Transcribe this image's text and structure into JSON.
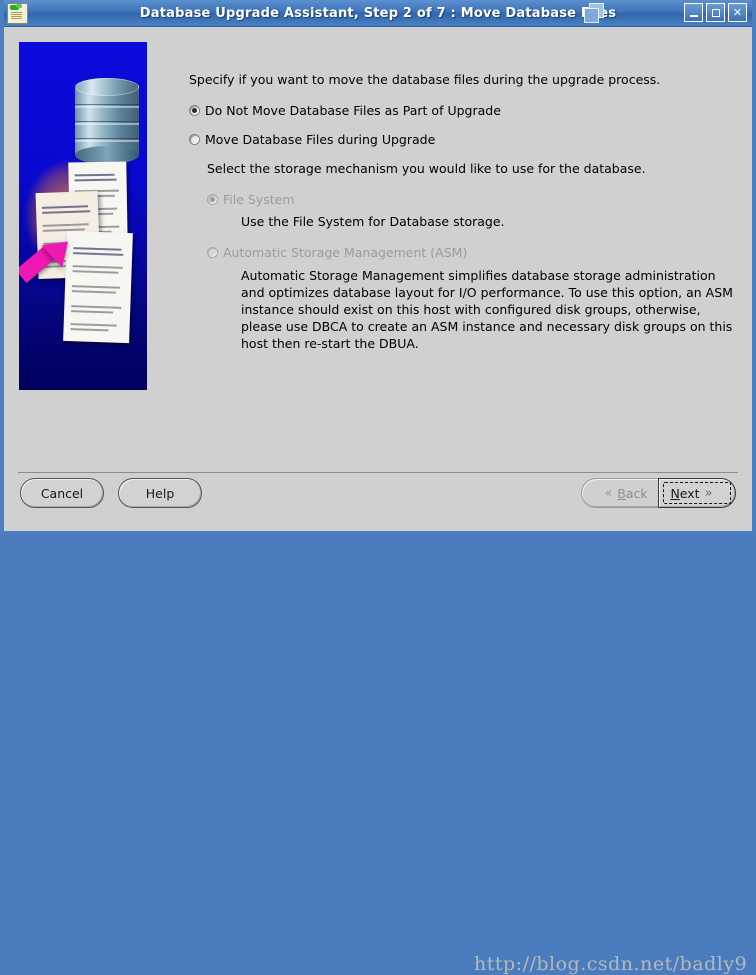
{
  "window": {
    "title": "Database Upgrade Assistant, Step 2 of 7 : Move Database Files",
    "app_icon": "database-upgrade-assistant-icon",
    "title_glyph": "stacked-windows-icon",
    "controls": {
      "minimize": "_",
      "maximize": "□",
      "close": "✕"
    }
  },
  "sidebar_graphic": {
    "name": "database-files-illustration",
    "background_top_color": "#0b0bdc",
    "background_bottom_color": "#00005c",
    "arrow_color": "#ef18b4",
    "glow_color": "#ff7a28"
  },
  "main": {
    "intro": "Specify if you want to move the database files during the upgrade process.",
    "options": [
      {
        "label": "Do Not Move Database Files as Part of Upgrade",
        "selected": true,
        "disabled": false
      },
      {
        "label": "Move Database Files during Upgrade",
        "selected": false,
        "disabled": false
      }
    ],
    "storage_prompt": "Select the storage mechanism you would like to use for the database.",
    "storage_options": [
      {
        "label": "File System",
        "selected": true,
        "disabled": true,
        "description": "Use the File System for Database storage."
      },
      {
        "label": "Automatic Storage Management (ASM)",
        "selected": false,
        "disabled": true,
        "description": "Automatic Storage Management simplifies database storage administration and optimizes database layout for I/O performance. To use this option, an ASM instance should exist on this host with configured disk groups, otherwise, please use DBCA to create an ASM instance and necessary disk groups on this host then re-start the DBUA."
      }
    ]
  },
  "footer": {
    "cancel_label": "Cancel",
    "help_label": "Help",
    "back": {
      "label": "Back",
      "mnemonic": "B",
      "rest": "ack",
      "chevron": "«",
      "disabled": true
    },
    "next": {
      "label": "Next",
      "mnemonic": "N",
      "rest": "ext",
      "chevron": "»",
      "focused": true
    }
  },
  "watermark": "http://blog.csdn.net/badly9"
}
